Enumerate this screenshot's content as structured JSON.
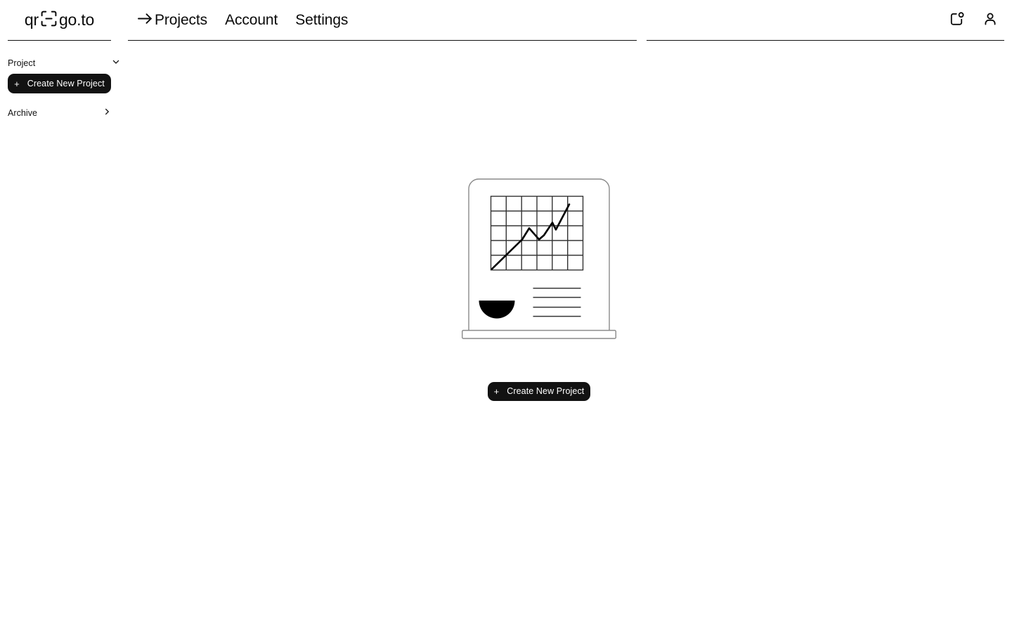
{
  "brand": {
    "name_left": "qr",
    "name_right": "go.to",
    "icon": "qr-scan-icon"
  },
  "header": {
    "nav": [
      {
        "label": "Projects",
        "active": true,
        "icon": "arrow-right-icon"
      },
      {
        "label": "Account",
        "active": false,
        "icon": ""
      },
      {
        "label": "Settings",
        "active": false,
        "icon": ""
      }
    ],
    "actions": [
      {
        "name": "notifications-icon",
        "badge": true
      },
      {
        "name": "user-account-icon",
        "badge": false
      }
    ]
  },
  "sidebar": {
    "project_label": "Project",
    "project_chevron": "chevron-down-icon",
    "create_button": {
      "label": "Create New Project",
      "icon": "plus-icon"
    },
    "archive_label": "Archive",
    "archive_chevron": "chevron-right-icon"
  },
  "main": {
    "illustration_name": "analytics-board-illustration",
    "create_button": {
      "label": "Create New Project",
      "icon": "plus-icon"
    }
  },
  "colors": {
    "background": "#ffffff",
    "text": "#111111",
    "button_bg": "#121212",
    "button_text": "#ffffff",
    "rule": "#111111",
    "illustration_outline": "#8a8a8a",
    "illustration_ink": "#000000"
  }
}
